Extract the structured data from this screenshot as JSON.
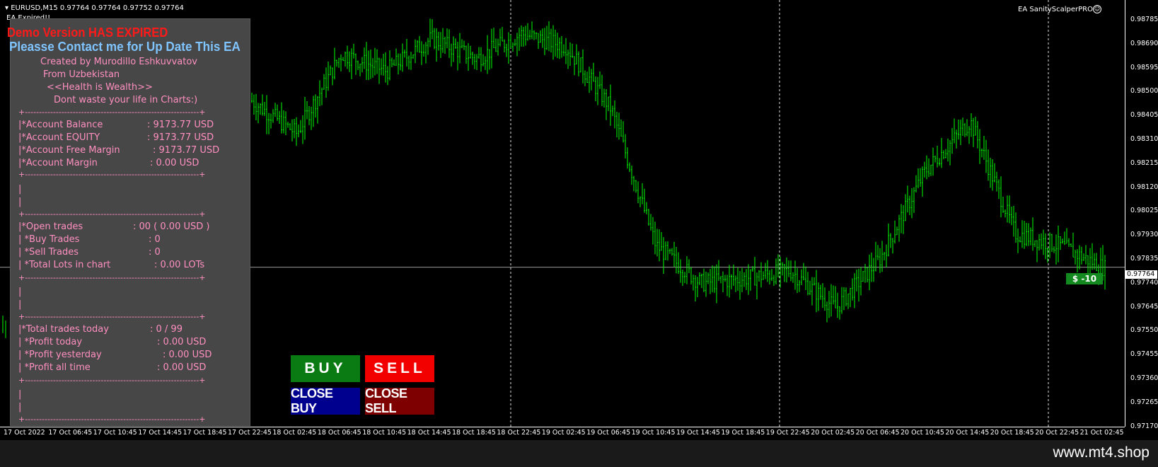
{
  "header": {
    "title": "EURUSD,M15  0.97764 0.97764 0.97752 0.97764",
    "ea_status": "EA Expired!!",
    "ea_name": "EA SanityScalperPRO",
    "smiley": "☺"
  },
  "panel": {
    "demo_expired": "Demo Version HAS EXPIRED",
    "contact": "Pleasse Contact me for Up Date This EA",
    "created_by": "Created by  Murodillo Eshkuvvatov",
    "from": "From Uzbekistan",
    "motto": "<<Health is Wealth>>",
    "tip": "Dont waste your life in Charts:)",
    "separator": "+--------------------------------------------------------------+",
    "bar": "|",
    "account": [
      {
        "label": "|*Account Balance",
        "value": ": 9173.77  USD"
      },
      {
        "label": "|*Account EQUITY",
        "value": ": 9173.77  USD"
      },
      {
        "label": "|*Account Free Margin",
        "value": ": 9173.77  USD"
      },
      {
        "label": "|*Account Margin",
        "value": ": 0.00  USD"
      }
    ],
    "open_trades": [
      {
        "label": "|*Open trades",
        "value": ": 00 ( 0.00 USD )"
      },
      {
        "label": "|       *Buy Trades",
        "value": ": 0"
      },
      {
        "label": "|       *Sell Trades",
        "value": ": 0"
      },
      {
        "label": "|       *Total Lots in chart",
        "value": ": 0.00 LOTs"
      }
    ],
    "today": [
      {
        "label": "|*Total trades today",
        "value": ": 0 / 99"
      },
      {
        "label": "|     *Profit today",
        "value": ": 0.00 USD"
      },
      {
        "label": "|     *Profit yesterday",
        "value": ": 0.00 USD"
      },
      {
        "label": "|     *Profit all time",
        "value": ": 0.00 USD"
      }
    ]
  },
  "buttons": {
    "buy": "BUY",
    "sell": "SELL",
    "close_buy": "CLOSE BUY",
    "close_sell": "CLOSE SELL"
  },
  "price_axis": {
    "ticks": [
      "0.98785",
      "0.98690",
      "0.98595",
      "0.98500",
      "0.98405",
      "0.98310",
      "0.98215",
      "0.98120",
      "0.98025",
      "0.97930",
      "0.97835",
      "0.97740",
      "0.97645",
      "0.97550",
      "0.97455",
      "0.97360",
      "0.97265",
      "0.97170"
    ],
    "current_price": "0.97764"
  },
  "time_axis": {
    "ticks": [
      "17 Oct 2022",
      "17 Oct 06:45",
      "17 Oct 10:45",
      "17 Oct 14:45",
      "17 Oct 18:45",
      "17 Oct 22:45",
      "18 Oct 02:45",
      "18 Oct 06:45",
      "18 Oct 10:45",
      "18 Oct 14:45",
      "18 Oct 18:45",
      "18 Oct 22:45",
      "19 Oct 02:45",
      "19 Oct 06:45",
      "19 Oct 10:45",
      "19 Oct 14:45",
      "19 Oct 18:45",
      "19 Oct 22:45",
      "20 Oct 02:45",
      "20 Oct 06:45",
      "20 Oct 10:45",
      "20 Oct 14:45",
      "20 Oct 18:45",
      "20 Oct 22:45",
      "21 Oct 02:45"
    ]
  },
  "profit_label": "$ -10",
  "watermark": "www.mt4.shop",
  "colors": {
    "candle": "#00ff00",
    "panel_text": "#ff8fc0",
    "buy": "#0a7a13",
    "sell": "#f20000"
  },
  "chart_data": {
    "type": "line",
    "title": "",
    "xlabel": "",
    "ylabel": "",
    "ylim": [
      0.97125,
      0.98835
    ],
    "current_price": 0.97764,
    "x": [
      "17 Oct 2022",
      "17 Oct 06:45",
      "17 Oct 10:45",
      "17 Oct 14:45",
      "17 Oct 18:45",
      "17 Oct 22:45",
      "18 Oct 02:45",
      "18 Oct 06:45",
      "18 Oct 10:45",
      "18 Oct 14:45",
      "18 Oct 18:45",
      "18 Oct 22:45",
      "19 Oct 02:45",
      "19 Oct 06:45",
      "19 Oct 10:45",
      "19 Oct 14:45",
      "19 Oct 18:45",
      "19 Oct 22:45",
      "20 Oct 02:45",
      "20 Oct 06:45",
      "20 Oct 10:45",
      "20 Oct 14:45",
      "20 Oct 18:45",
      "20 Oct 22:45",
      "21 Oct 02:45"
    ],
    "series": [
      {
        "values": [
          0.975,
          0.9752,
          0.9755,
          0.9758,
          0.976,
          0.9843,
          0.983,
          0.9862,
          0.9855,
          0.9868,
          0.986,
          0.987,
          0.9865,
          0.984,
          0.9785,
          0.977,
          0.9772,
          0.9775,
          0.976,
          0.978,
          0.9815,
          0.9835,
          0.979,
          0.9785,
          0.9776
        ]
      }
    ]
  }
}
